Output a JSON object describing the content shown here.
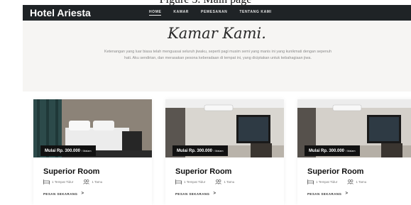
{
  "figure_caption": "Figure 5. Main page",
  "navbar": {
    "brand": "Hotel Ariesta",
    "links": [
      "HOME",
      "KAMAR",
      "PEMESANAN",
      "TENTANG KAMI"
    ],
    "active": "HOME"
  },
  "hero": {
    "title": "Kamar Kami.",
    "text": "Ketenangan yang luar biasa telah menguasai seluruh jiwaku, seperti pagi musim semi yang manis ini yang kunikmati dengan sepenuh hati. Aku sendirian, dan merasakan pesona keberadaan di tempat ini, yang diciptakan untuk kebahagiaan jiwa."
  },
  "rooms": [
    {
      "price": "Mulai Rp. 300.000",
      "unit": "/ Malam",
      "name": "Superior Room",
      "bed": "1 Tempat Tidur",
      "guest": "1 Tamu",
      "cta": "PESAN SEKARANG",
      "cta_arrow": ">"
    },
    {
      "price": "Mulai Rp. 300.000",
      "unit": "/ Malam",
      "name": "Superior Room",
      "bed": "1 Tempat Tidur",
      "guest": "1 Tamu",
      "cta": "PESAN SEKARANG",
      "cta_arrow": ">"
    },
    {
      "price": "Mulai Rp. 300.000",
      "unit": "/ Malam",
      "name": "Superior Room",
      "bed": "1 Tempat Tidur",
      "guest": "1 Tamu",
      "cta": "PESAN SEKARANG",
      "cta_arrow": ">"
    }
  ],
  "icons": {
    "bed": "bed-icon",
    "guest": "guest-icon",
    "arrow": "chevron-right-icon"
  }
}
